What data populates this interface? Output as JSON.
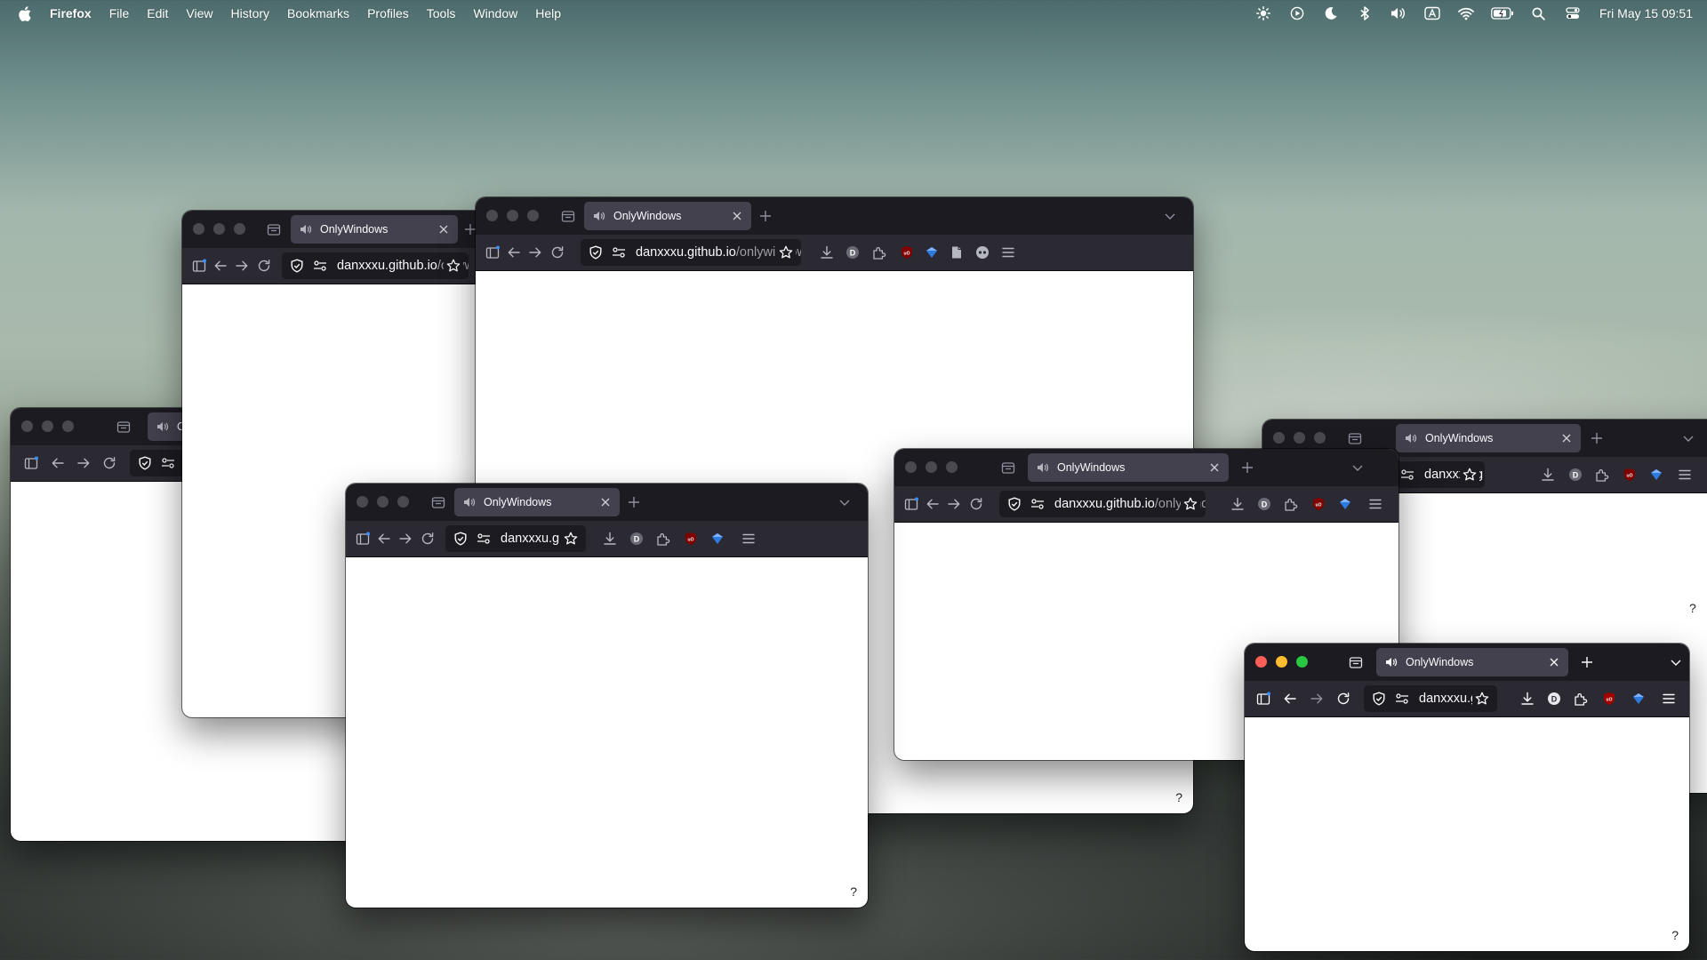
{
  "menubar": {
    "app_name": "Firefox",
    "items": [
      "File",
      "Edit",
      "View",
      "History",
      "Bookmarks",
      "Profiles",
      "Tools",
      "Window",
      "Help"
    ],
    "clock": "Fri May 15  09:51",
    "status_icons": [
      "brightness-icon",
      "play-icon",
      "moon-icon",
      "bluetooth-icon",
      "volume-icon",
      "input-source-icon",
      "wifi-icon",
      "battery-icon",
      "search-icon",
      "control-center-icon"
    ]
  },
  "browser": {
    "tab_title": "OnlyWindows",
    "url_full_domain": "danxxxu.github.io",
    "url_short_domain": "danxxxu.g",
    "url_tiny_domain": "danxx",
    "url_path": "/onlywindows",
    "help_label": "?"
  },
  "windows": [
    {
      "id": "w1",
      "active": false
    },
    {
      "id": "w2",
      "active": false
    },
    {
      "id": "w3",
      "active": false
    },
    {
      "id": "w4",
      "active": false
    },
    {
      "id": "w5",
      "active": false
    },
    {
      "id": "w6",
      "active": false
    },
    {
      "id": "w7",
      "active": true
    }
  ],
  "colors": {
    "titlebar": "#1c1b22",
    "toolbar": "#2b2a33",
    "tab_selected": "#42414d",
    "urlbar": "#1c1b22",
    "close_light": "#ff5f57",
    "min_light": "#febc2e",
    "max_light": "#28c840"
  }
}
